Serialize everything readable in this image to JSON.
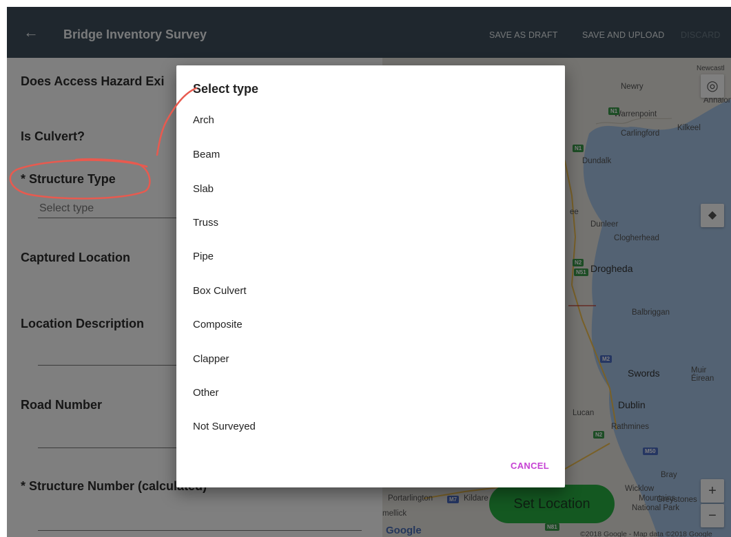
{
  "toolbar": {
    "back_icon": "arrow-left-icon",
    "title": "Bridge Inventory Survey",
    "save_draft": "SAVE AS DRAFT",
    "save_upload": "SAVE AND UPLOAD",
    "discard": "DISCARD"
  },
  "form": {
    "access_hazard": "Does Access Hazard Exi",
    "is_culvert": "Is Culvert?",
    "structure_type": "* Structure Type",
    "structure_type_placeholder": "Select type",
    "captured_location": "Captured Location",
    "location_description": "Location Description",
    "road_number": "Road Number",
    "structure_number": "* Structure Number (calculated)"
  },
  "map": {
    "towns": [
      "Newcastl",
      "Newry",
      "Annalong",
      "Warrenpoint",
      "Kilkeel",
      "Carlingford",
      "Dundalk",
      "Dunleer",
      "Clogherhead",
      "Drogheda",
      "Balbriggan",
      "Swords",
      "Muir Éirean",
      "Dublin",
      "Lucan",
      "Rathmines",
      "Bray",
      "Wicklow",
      "Mountains",
      "National Park",
      "Greystones",
      "Portarlington",
      "Kildare",
      "mellick",
      "ee"
    ],
    "shields": [
      "N1",
      "N1",
      "N2",
      "N51",
      "M2",
      "N2",
      "M50",
      "M7",
      "N81"
    ],
    "set_location": "Set Location",
    "google": "Google",
    "copyright": "©2018 Google - Map data ©2018 Google",
    "zoom_in": "+",
    "zoom_out": "−",
    "locate_icon": "my-location-icon",
    "layers_icon": "layers-icon"
  },
  "dialog": {
    "title": "Select type",
    "options": [
      "Arch",
      "Beam",
      "Slab",
      "Truss",
      "Pipe",
      "Box Culvert",
      "Composite",
      "Clapper",
      "Other",
      "Not Surveyed"
    ],
    "cancel": "CANCEL"
  },
  "colors": {
    "toolbar": "#3f4f5c",
    "cancel_accent": "#c642d4",
    "set_location_button": "#28b042",
    "annotation": "#e85a4f",
    "sea": "#a6c4e6"
  }
}
